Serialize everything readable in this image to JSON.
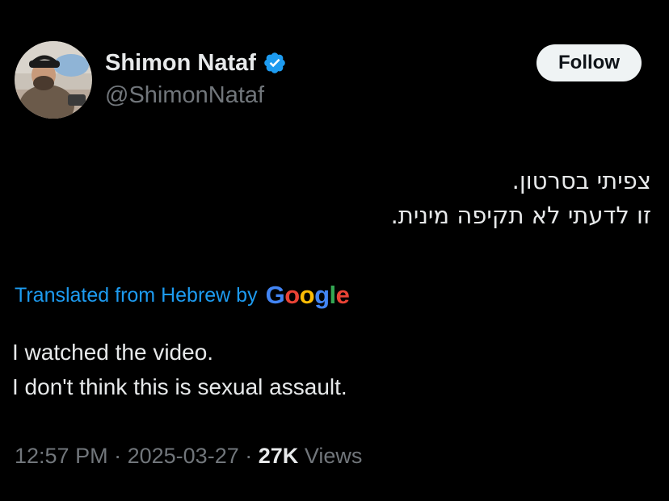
{
  "author": {
    "name": "Shimon Nataf",
    "handle": "@ShimonNataf",
    "verified_icon": "verified-badge-icon",
    "verified_color": "#1d9bf0"
  },
  "follow_button": {
    "label": "Follow"
  },
  "tweet": {
    "original_lines": [
      "צפיתי בסרטון.",
      "זו לדעתי לא תקיפה מינית."
    ],
    "translation_notice": "Translated from Hebrew by",
    "translation_provider": "Google",
    "translated_lines": [
      "I watched the video.",
      "I don't think this is sexual assault."
    ]
  },
  "meta": {
    "time": "12:57 PM",
    "separator": "·",
    "date": "2025-03-27",
    "views_count": "27K",
    "views_label": "Views"
  },
  "colors": {
    "background": "#000000",
    "primary_text": "#e7e9ea",
    "secondary_text": "#71767b",
    "link": "#1d9bf0"
  }
}
